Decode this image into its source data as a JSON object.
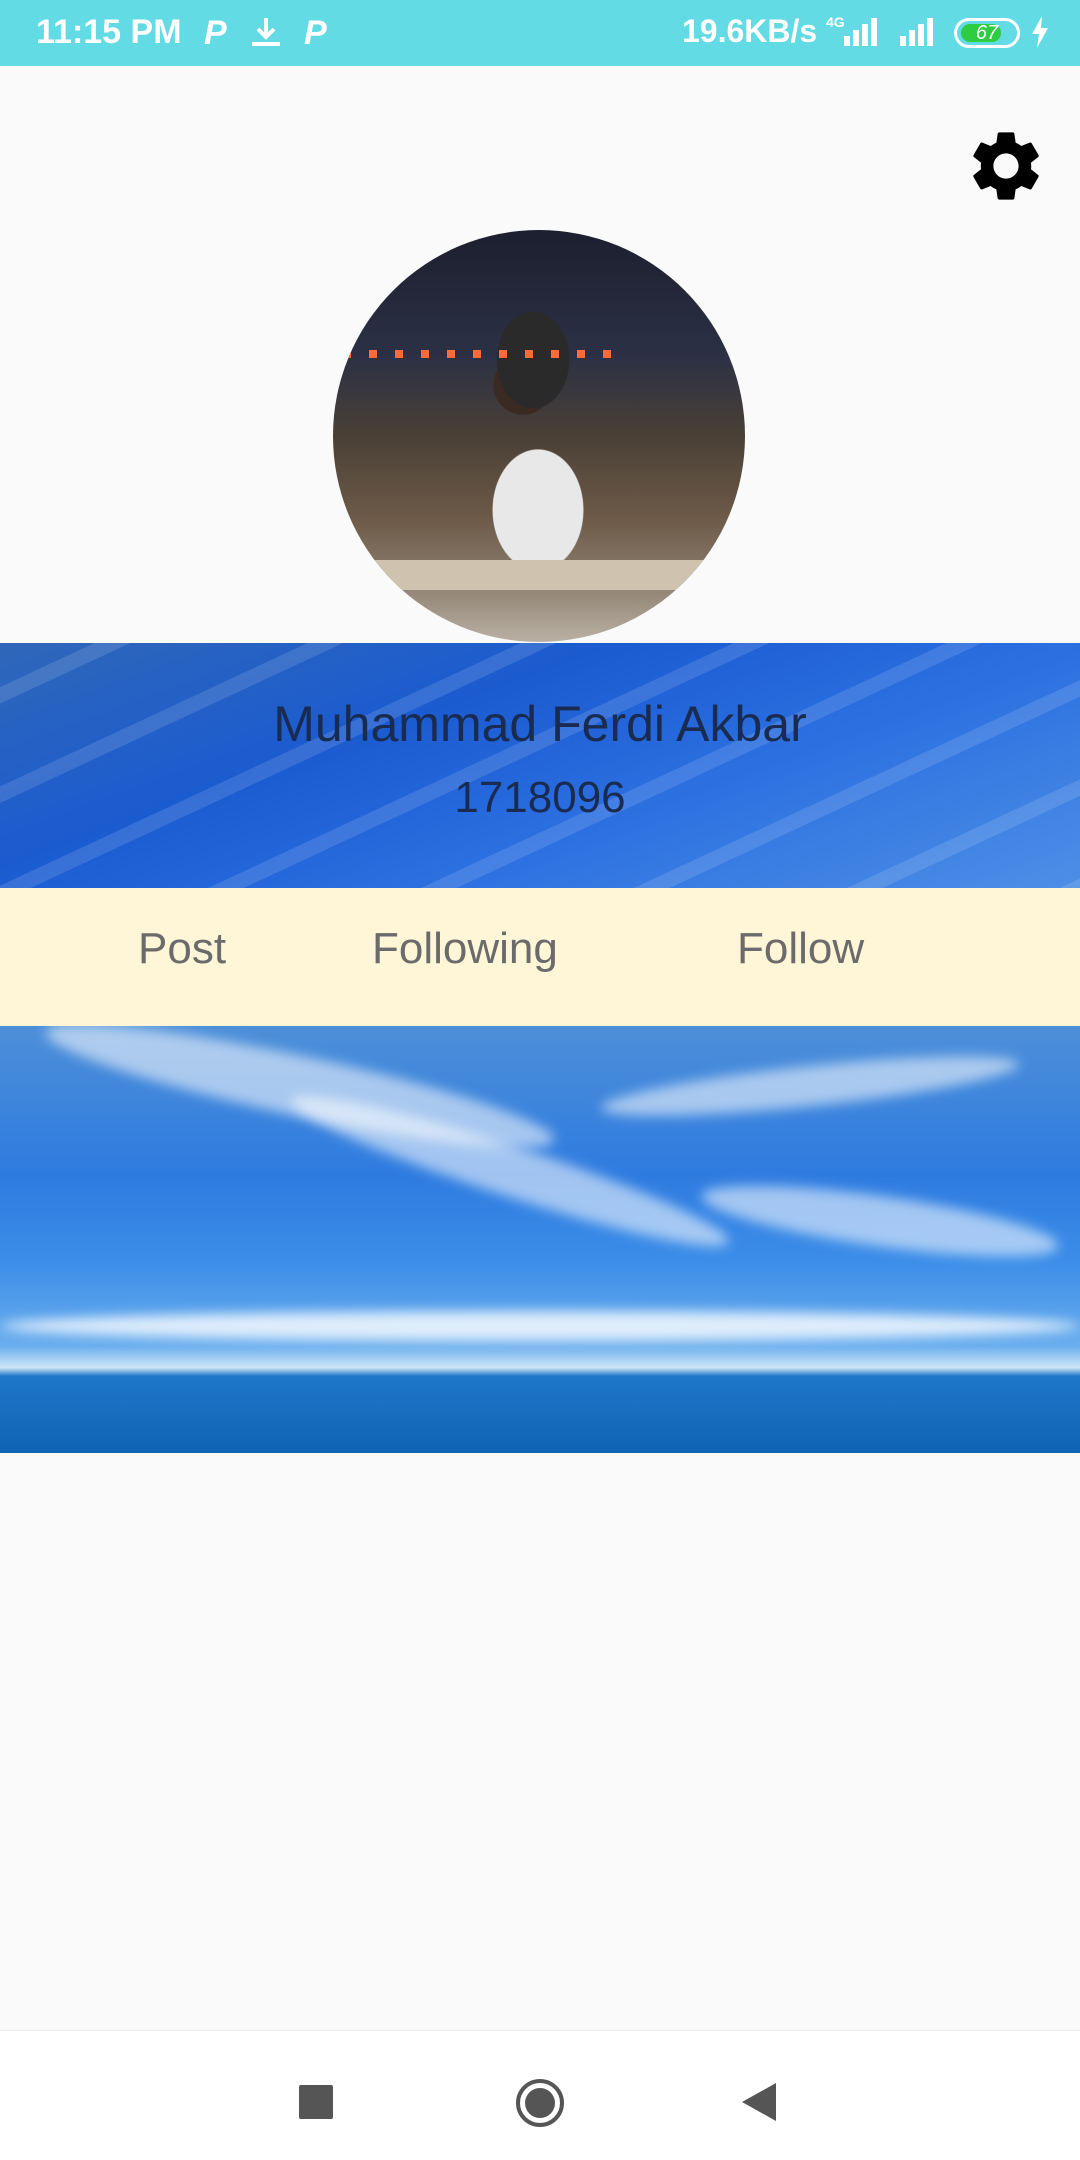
{
  "status_bar": {
    "time": "11:15 PM",
    "speed": "19.6KB/s",
    "network": "4G",
    "battery": "67",
    "icons": [
      "p-icon",
      "download-icon",
      "p-icon",
      "signal-icon",
      "signal-icon",
      "battery-icon",
      "charging-icon"
    ]
  },
  "profile": {
    "name": "Muhammad Ferdi Akbar",
    "id": "1718096"
  },
  "tabs": {
    "post": "Post",
    "following": "Following",
    "follow": "Follow"
  },
  "colors": {
    "status_bar": "#63dbe5",
    "tabs_bg": "#fff6d8",
    "name_text": "#1a2b52",
    "tab_text": "#6b6b6b"
  }
}
